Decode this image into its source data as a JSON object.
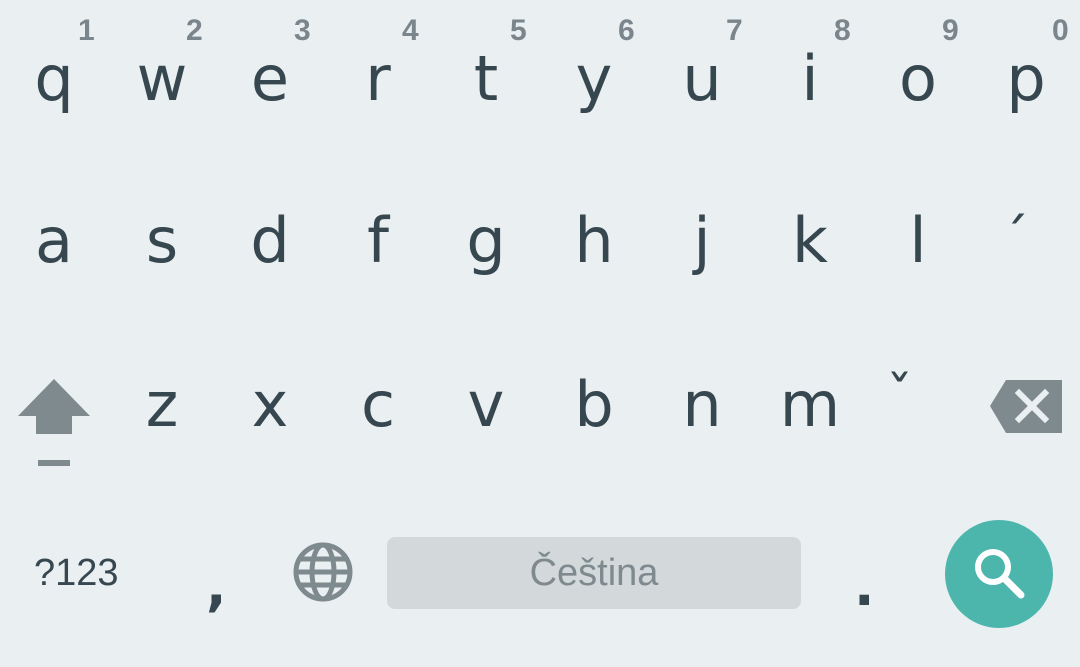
{
  "keyboard": {
    "row1": [
      {
        "letter": "q",
        "hint": "1"
      },
      {
        "letter": "w",
        "hint": "2"
      },
      {
        "letter": "e",
        "hint": "3"
      },
      {
        "letter": "r",
        "hint": "4"
      },
      {
        "letter": "t",
        "hint": "5"
      },
      {
        "letter": "y",
        "hint": "6"
      },
      {
        "letter": "u",
        "hint": "7"
      },
      {
        "letter": "i",
        "hint": "8"
      },
      {
        "letter": "o",
        "hint": "9"
      },
      {
        "letter": "p",
        "hint": "0"
      }
    ],
    "row2": [
      "a",
      "s",
      "d",
      "f",
      "g",
      "h",
      "j",
      "k",
      "l",
      "´"
    ],
    "row3": [
      "z",
      "x",
      "c",
      "v",
      "b",
      "n",
      "m",
      "ˇ"
    ],
    "bottom": {
      "symbols_label": "?123",
      "comma_label": ",",
      "space_label": "Čeština",
      "period_label": "."
    },
    "icons": {
      "shift": "shift-arrow-icon",
      "backspace": "backspace-icon",
      "globe": "globe-icon",
      "search": "search-icon"
    },
    "colors": {
      "background": "#eaeff2",
      "key_text": "#37474f",
      "hint_text": "#7b868c",
      "icon_gray": "#7f8a8f",
      "space_bar": "#d3d8db",
      "accent": "#4db6ac"
    }
  }
}
